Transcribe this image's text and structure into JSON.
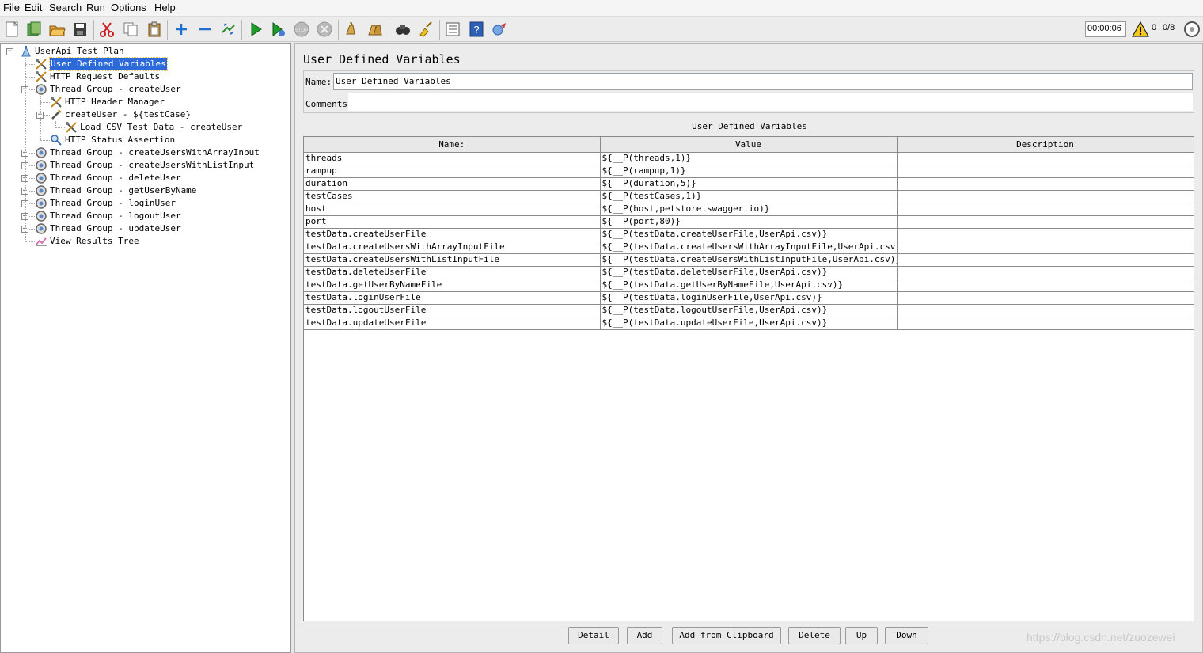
{
  "menu": [
    "File",
    "Edit",
    "Search",
    "Run",
    "Options",
    "Help"
  ],
  "toolbar": {
    "icons": [
      "new-icon",
      "templates-icon",
      "open-icon",
      "save-icon",
      "cut-icon",
      "copy-icon",
      "paste-icon",
      "expand-icon",
      "collapse-icon",
      "toggle-icon",
      "start-icon",
      "start-no-pause-icon",
      "stop-icon",
      "shutdown-icon",
      "clear-icon",
      "clear-all-icon",
      "search-icon",
      "reset-search-icon",
      "function-helper-icon",
      "help-icon",
      "remote-icon"
    ],
    "timer": "00:00:06",
    "warning_count": "0",
    "threads": "0/8"
  },
  "tree": [
    {
      "label": "UserApi Test Plan",
      "icon": "test-plan-icon",
      "depth": 0,
      "expander": "minus",
      "selected": false
    },
    {
      "label": "User Defined Variables",
      "icon": "config-element-icon",
      "depth": 1,
      "expander": "",
      "selected": true
    },
    {
      "label": "HTTP Request Defaults",
      "icon": "config-element-icon",
      "depth": 1,
      "expander": "",
      "selected": false
    },
    {
      "label": "Thread Group - createUser",
      "icon": "thread-group-icon",
      "depth": 1,
      "expander": "minus",
      "selected": false
    },
    {
      "label": "HTTP Header Manager",
      "icon": "config-element-icon",
      "depth": 2,
      "expander": "",
      "selected": false
    },
    {
      "label": "createUser - ${testCase}",
      "icon": "sampler-icon",
      "depth": 2,
      "expander": "minus",
      "selected": false
    },
    {
      "label": "Load CSV Test Data - createUser",
      "icon": "config-element-icon",
      "depth": 3,
      "expander": "",
      "selected": false
    },
    {
      "label": "HTTP Status Assertion",
      "icon": "assertion-icon",
      "depth": 2,
      "expander": "",
      "selected": false
    },
    {
      "label": "Thread Group - createUsersWithArrayInput",
      "icon": "thread-group-icon",
      "depth": 1,
      "expander": "plus",
      "selected": false
    },
    {
      "label": "Thread Group - createUsersWithListInput",
      "icon": "thread-group-icon",
      "depth": 1,
      "expander": "plus",
      "selected": false
    },
    {
      "label": "Thread Group - deleteUser",
      "icon": "thread-group-icon",
      "depth": 1,
      "expander": "plus",
      "selected": false
    },
    {
      "label": "Thread Group - getUserByName",
      "icon": "thread-group-icon",
      "depth": 1,
      "expander": "plus",
      "selected": false
    },
    {
      "label": "Thread Group - loginUser",
      "icon": "thread-group-icon",
      "depth": 1,
      "expander": "plus",
      "selected": false
    },
    {
      "label": "Thread Group - logoutUser",
      "icon": "thread-group-icon",
      "depth": 1,
      "expander": "plus",
      "selected": false
    },
    {
      "label": "Thread Group - updateUser",
      "icon": "thread-group-icon",
      "depth": 1,
      "expander": "plus",
      "selected": false
    },
    {
      "label": "View Results Tree",
      "icon": "listener-icon",
      "depth": 1,
      "expander": "",
      "selected": false
    }
  ],
  "panel": {
    "title": "User Defined Variables",
    "name_label": "Name:",
    "name_value": "User Defined Variables",
    "comments_label": "Comments:",
    "comments_value": "",
    "table_caption": "User Defined Variables",
    "columns": [
      "Name:",
      "Value",
      "Description"
    ],
    "rows": [
      [
        "threads",
        "${__P(threads,1)}",
        ""
      ],
      [
        "rampup",
        "${__P(rampup,1)}",
        ""
      ],
      [
        "duration",
        "${__P(duration,5)}",
        ""
      ],
      [
        "testCases",
        "${__P(testCases,1)}",
        ""
      ],
      [
        "host",
        "${__P(host,petstore.swagger.io)}",
        ""
      ],
      [
        "port",
        "${__P(port,80)}",
        ""
      ],
      [
        "testData.createUserFile",
        "${__P(testData.createUserFile,UserApi.csv)}",
        ""
      ],
      [
        "testData.createUsersWithArrayInputFile",
        "${__P(testData.createUsersWithArrayInputFile,UserApi.csv)}",
        ""
      ],
      [
        "testData.createUsersWithListInputFile",
        "${__P(testData.createUsersWithListInputFile,UserApi.csv)}",
        ""
      ],
      [
        "testData.deleteUserFile",
        "${__P(testData.deleteUserFile,UserApi.csv)}",
        ""
      ],
      [
        "testData.getUserByNameFile",
        "${__P(testData.getUserByNameFile,UserApi.csv)}",
        ""
      ],
      [
        "testData.loginUserFile",
        "${__P(testData.loginUserFile,UserApi.csv)}",
        ""
      ],
      [
        "testData.logoutUserFile",
        "${__P(testData.logoutUserFile,UserApi.csv)}",
        ""
      ],
      [
        "testData.updateUserFile",
        "${__P(testData.updateUserFile,UserApi.csv)}",
        ""
      ]
    ],
    "buttons": [
      "Detail",
      "Add",
      "Add from Clipboard",
      "Delete",
      "Up",
      "Down"
    ]
  },
  "watermark": "https://blog.csdn.net/zuozewei"
}
